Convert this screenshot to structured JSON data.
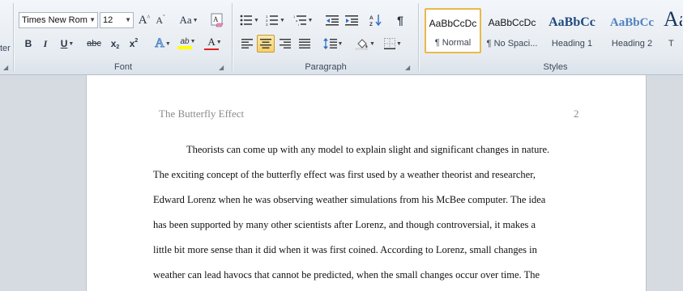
{
  "ribbon": {
    "clipboard": {
      "partial_label": "ter"
    },
    "font": {
      "label": "Font",
      "font_name": "Times New Rom",
      "font_size": "12",
      "grow": "A",
      "shrink": "A",
      "change_case": "Aa",
      "clear_format": "A",
      "bold": "B",
      "italic": "I",
      "underline": "U",
      "strike": "abc",
      "subscript": "x",
      "superscript": "x",
      "effects": "A",
      "highlight": "ab",
      "font_color": "A"
    },
    "paragraph": {
      "label": "Paragraph",
      "pilcrow": "¶"
    },
    "styles": {
      "label": "Styles",
      "items": [
        {
          "sample": "AaBbCcDc",
          "name": "¶ Normal"
        },
        {
          "sample": "AaBbCcDc",
          "name": "¶ No Spaci..."
        },
        {
          "sample": "AaBbCc",
          "name": "Heading 1"
        },
        {
          "sample": "AaBbCc",
          "name": "Heading 2"
        },
        {
          "sample": "Aa",
          "name": "T"
        }
      ]
    },
    "colors": {
      "highlight": "#ffff00",
      "font_color": "#e02020",
      "heading": "#1f497d"
    }
  },
  "document": {
    "header_title": "The Butterfly Effect",
    "page_number": "2",
    "lines": [
      "Theorists can come up with any model to explain slight and significant changes in nature.",
      "The exciting concept of the butterfly effect was first used by a weather theorist and researcher,",
      "Edward Lorenz when he was observing weather simulations from his McBee computer. The idea",
      "has been supported by many other scientists after Lorenz, and though controversial, it makes a",
      "little bit more sense than it did when it was first coined. According to Lorenz, small changes in",
      "weather can lead havocs that cannot be predicted, when the small changes occur over time. The"
    ]
  }
}
